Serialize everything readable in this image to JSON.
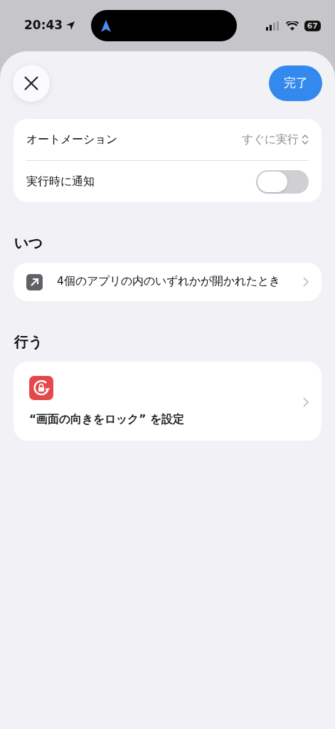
{
  "status_bar": {
    "time": "20:43",
    "battery": "67"
  },
  "header": {
    "done_button": "完了"
  },
  "settings": [
    {
      "kind": "picker",
      "label": "オートメーション",
      "value": "すぐに実行"
    },
    {
      "kind": "toggle",
      "label": "実行時に通知",
      "on": false
    }
  ],
  "sections": [
    {
      "title": "いつ",
      "items": [
        {
          "kind": "app-open",
          "text": "4個のアプリの内のいずれかが開かれたとき"
        }
      ]
    },
    {
      "title": "行う",
      "items": [
        {
          "kind": "orientation-lock",
          "text": "“画面の向きをロック” を設定"
        }
      ]
    }
  ]
}
